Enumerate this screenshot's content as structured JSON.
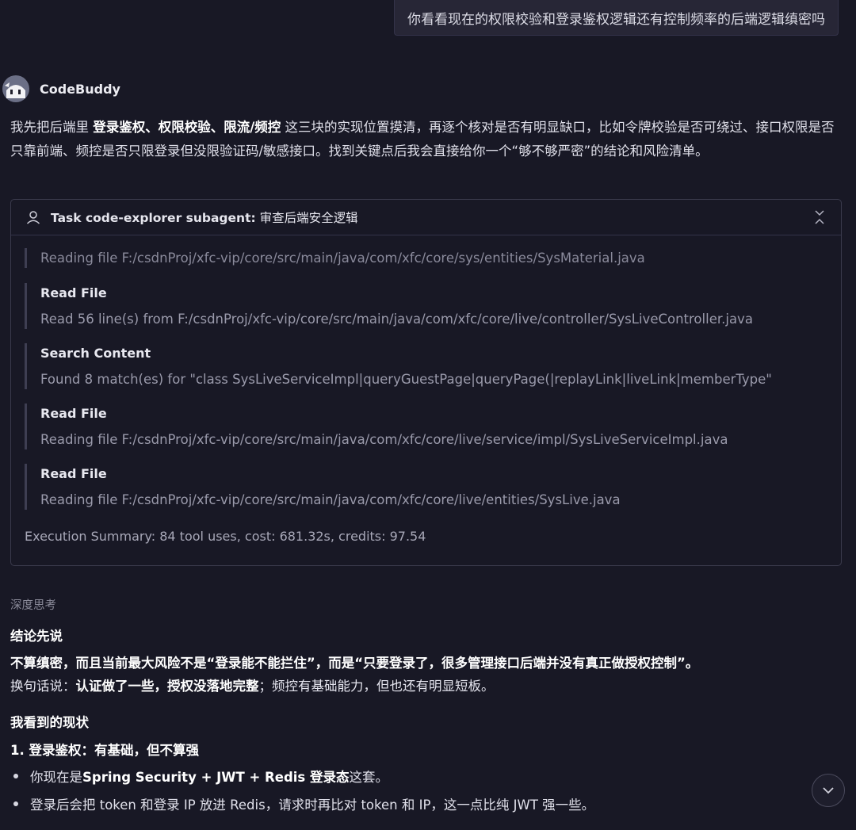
{
  "user_message": "你看看现在的权限校验和登录鉴权逻辑还有控制频率的后端逻辑缜密吗",
  "assistant": {
    "name": "CodeBuddy",
    "intro": {
      "part1": "我先把后端里 ",
      "bold": "登录鉴权、权限校验、限流/频控",
      "part2": " 这三块的实现位置摸清，再逐个核对是否有明显缺口，比如令牌校验是否可绕过、接口权限是否只靠前端、频控是否只限登录但没限验证码/敏感接口。找到关键点后我会直接给你一个“够不够严密”的结论和风险清单。"
    }
  },
  "task": {
    "title_bold": "Task code-explorer subagent:",
    "title_rest": " 审查后端安全逻辑",
    "entries": [
      {
        "title": "",
        "text": "Reading file F:/csdnProj/xfc-vip/core/src/main/java/com/xfc/core/sys/entities/SysMaterial.java"
      },
      {
        "title": "Read File",
        "text": "Read 56 line(s) from F:/csdnProj/xfc-vip/core/src/main/java/com/xfc/core/live/controller/SysLiveController.java"
      },
      {
        "title": "Search Content",
        "text": "Found 8 match(es) for \"class SysLiveServiceImpl|queryGuestPage|queryPage(|replayLink|liveLink|memberType\""
      },
      {
        "title": "Read File",
        "text": "Reading file F:/csdnProj/xfc-vip/core/src/main/java/com/xfc/core/live/service/impl/SysLiveServiceImpl.java"
      },
      {
        "title": "Read File",
        "text": "Reading file F:/csdnProj/xfc-vip/core/src/main/java/com/xfc/core/live/entities/SysLive.java"
      }
    ],
    "summary": "Execution Summary: 84 tool uses, cost: 681.32s, credits: 97.54"
  },
  "answer": {
    "deep_think_label": "深度思考",
    "conclusion_heading": "结论先说",
    "conclusion_line1": "不算缜密，而且当前最大风险不是“登录能不能拦住”，而是“只要登录了，很多管理接口后端并没有真正做授权控制”。",
    "conclusion_line2_prefix": "换句话说：",
    "conclusion_line2_bold": "认证做了一些，授权没落地完整",
    "conclusion_line2_suffix": "；频控有基础能力，但也还有明显短板。",
    "status_heading": "我看到的现状",
    "login_heading": "1. 登录鉴权：有基础，但不算强",
    "bullet1_prefix": "你现在是 ",
    "bullet1_bold": "Spring Security + JWT + Redis 登录态",
    "bullet1_suffix": " 这套。",
    "bullet2": "登录后会把 token 和登录 IP 放进 Redis，请求时再比对 token 和 IP，这一点比纯 JWT 强一些。"
  }
}
